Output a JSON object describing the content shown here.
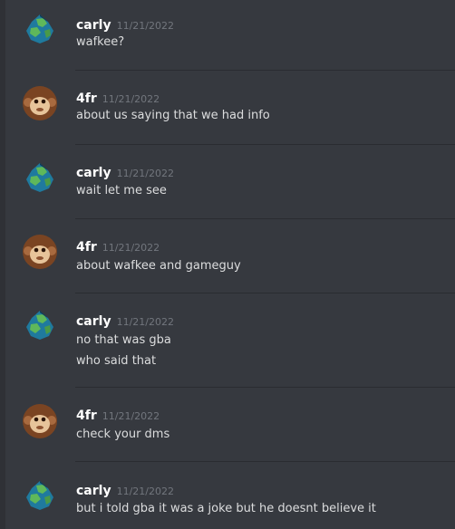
{
  "messages": [
    {
      "author": "carly",
      "timestamp": "11/21/2022",
      "avatar": "earth-icon",
      "lines": [
        "wafkee?"
      ]
    },
    {
      "author": "4fr",
      "timestamp": "11/21/2022",
      "avatar": "monkey-icon",
      "lines": [
        "about us saying that we had info"
      ]
    },
    {
      "author": "carly",
      "timestamp": "11/21/2022",
      "avatar": "earth-icon",
      "lines": [
        "wait let me see"
      ]
    },
    {
      "author": "4fr",
      "timestamp": "11/21/2022",
      "avatar": "monkey-icon",
      "lines": [
        "about wafkee and gameguy"
      ]
    },
    {
      "author": "carly",
      "timestamp": "11/21/2022",
      "avatar": "earth-icon",
      "lines": [
        "no that was gba",
        "who said that"
      ]
    },
    {
      "author": "4fr",
      "timestamp": "11/21/2022",
      "avatar": "monkey-icon",
      "lines": [
        "check your dms"
      ]
    },
    {
      "author": "carly",
      "timestamp": "11/21/2022",
      "avatar": "earth-icon",
      "lines": [
        "but i told gba it was a joke but he doesnt believe it"
      ]
    }
  ],
  "colors": {
    "background": "#36393f",
    "username": "#ffffff",
    "timestamp": "#72767d",
    "text": "#dcddde"
  }
}
